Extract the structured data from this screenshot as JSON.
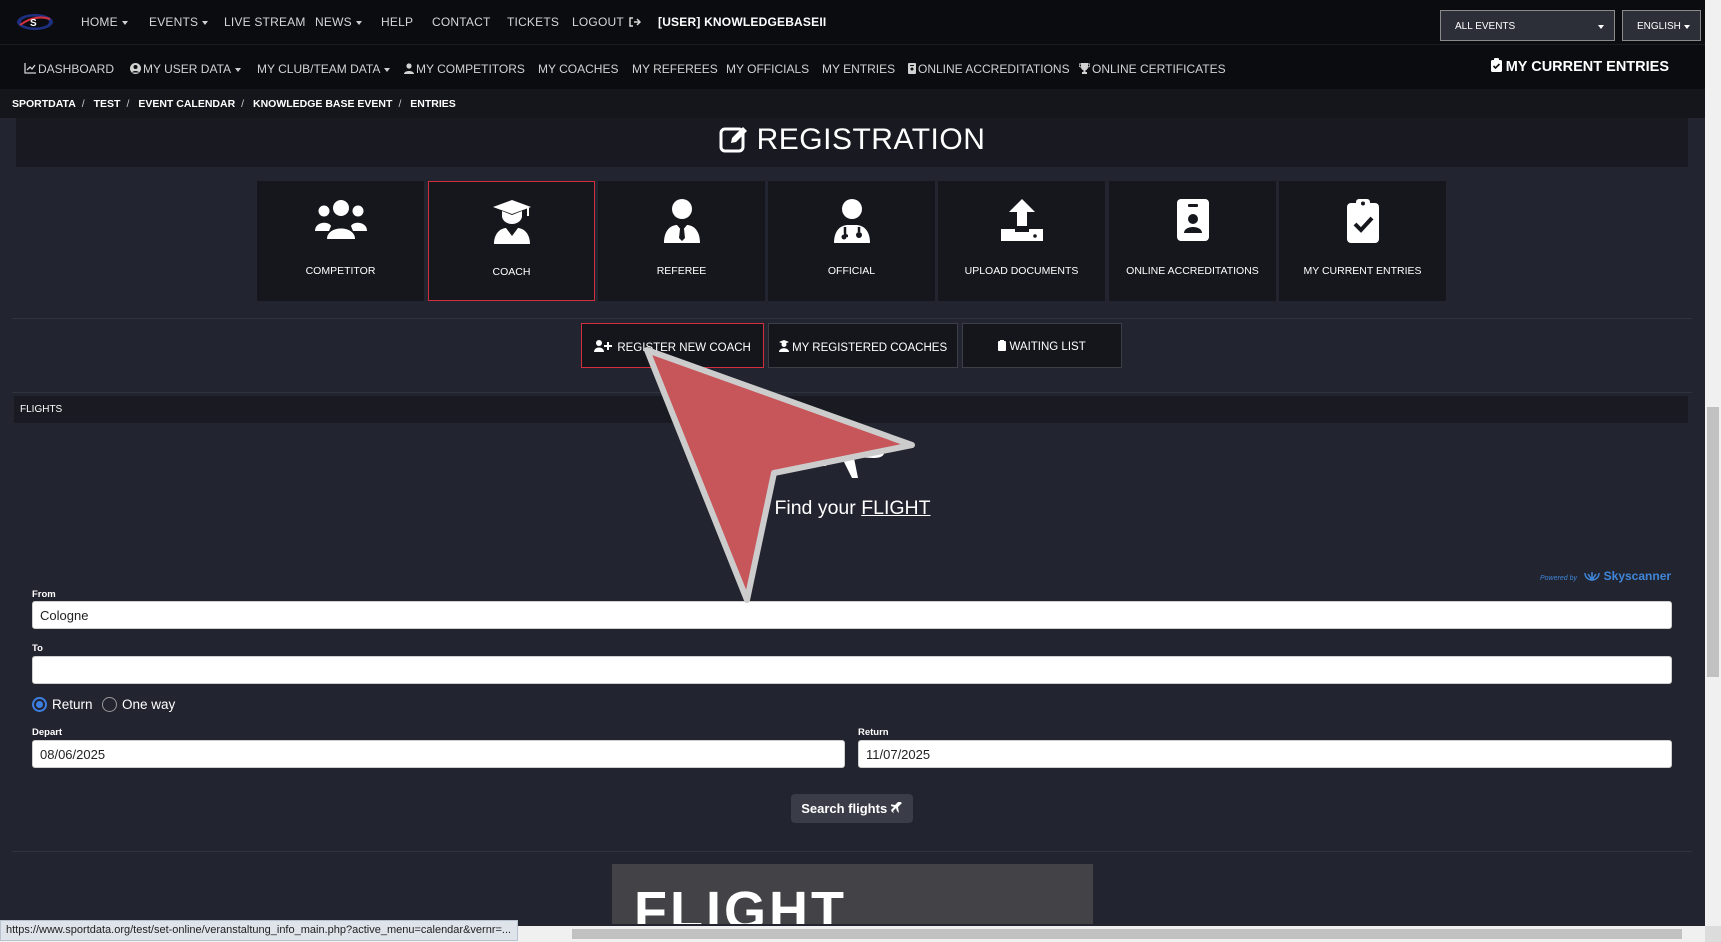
{
  "topnav": {
    "logo_text": "S",
    "home": "HOME",
    "events": "EVENTS",
    "live_stream": "LIVE STREAM",
    "news": "NEWS",
    "help": "HELP",
    "contact": "CONTACT",
    "tickets": "TICKETS",
    "logout": "LOGOUT",
    "user": "[USER] KNOWLEDGEBASEII",
    "event_select": "ALL EVENTS",
    "language_select": "ENGLISH"
  },
  "subnav": {
    "dashboard": "DASHBOARD",
    "my_user_data": "MY USER DATA",
    "my_club_team_data": "MY CLUB/TEAM DATA",
    "my_competitors": "MY COMPETITORS",
    "my_coaches": "MY COACHES",
    "my_referees": "MY REFEREES",
    "my_officials": "MY OFFICIALS",
    "my_entries": "MY ENTRIES",
    "online_accreditations": "ONLINE ACCREDITATIONS",
    "online_certificates": "ONLINE CERTIFICATES",
    "my_current_entries": "MY CURRENT ENTRIES"
  },
  "breadcrumb": [
    "SPORTDATA",
    "TEST",
    "EVENT CALENDAR",
    "KNOWLEDGE BASE EVENT",
    "ENTRIES"
  ],
  "registration": {
    "title": "REGISTRATION",
    "tiles": [
      "COMPETITOR",
      "COACH",
      "REFEREE",
      "OFFICIAL",
      "UPLOAD DOCUMENTS",
      "ONLINE ACCREDITATIONS",
      "MY CURRENT ENTRIES"
    ],
    "active_tile": "COACH"
  },
  "coach_actions": {
    "register_new": "REGISTER NEW COACH",
    "my_registered": "MY REGISTERED COACHES",
    "waiting_list": "WAITING LIST"
  },
  "flights": {
    "section_title": "FLIGHTS",
    "find_prefix": "Find your",
    "find_link": "FLIGHT",
    "powered_by": "Powered by",
    "provider": "Skyscanner",
    "from_label": "From",
    "from_value": "Cologne",
    "to_label": "To",
    "to_value": "",
    "trip_return": "Return",
    "trip_one_way": "One way",
    "trip_selected": "Return",
    "depart_label": "Depart",
    "depart_value": "08/06/2025",
    "return_label": "Return",
    "return_value": "11/07/2025",
    "search_button": "Search flights",
    "banner_text": "FLIGHT"
  },
  "status_bar_url": "https://www.sportdata.org/test/set-online/veranstaltung_info_main.php?active_menu=calendar&vernr=...",
  "colors": {
    "accent_red": "#d0303d",
    "link_blue": "#3f86d8",
    "background": "#222430",
    "nav_background": "#0b0c10"
  }
}
